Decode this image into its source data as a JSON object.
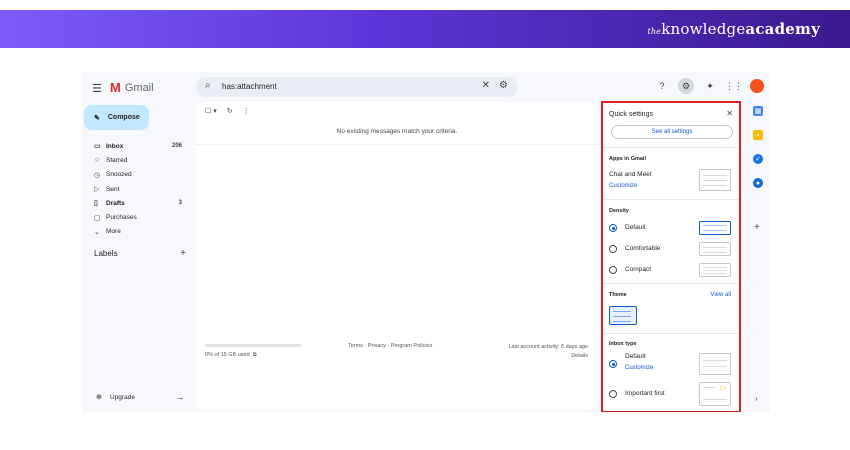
{
  "banner": {
    "brand_the": "the",
    "brand_knowledge": "knowledge",
    "brand_academy": "academy"
  },
  "app": {
    "name": "Gmail"
  },
  "search": {
    "query": "has:attachment"
  },
  "compose": {
    "label": "Compose"
  },
  "nav": [
    {
      "label": "Inbox",
      "count": "206",
      "icon": "inbox-icon",
      "glyph": "▭",
      "bold": true
    },
    {
      "label": "Starred",
      "count": "",
      "icon": "star-icon",
      "glyph": "☆",
      "bold": false
    },
    {
      "label": "Snoozed",
      "count": "",
      "icon": "clock-icon",
      "glyph": "◷",
      "bold": false
    },
    {
      "label": "Sent",
      "count": "",
      "icon": "send-icon",
      "glyph": "▷",
      "bold": false
    },
    {
      "label": "Drafts",
      "count": "3",
      "icon": "draft-icon",
      "glyph": "▯",
      "bold": true
    },
    {
      "label": "Purchases",
      "count": "",
      "icon": "bag-icon",
      "glyph": "▢",
      "bold": false
    },
    {
      "label": "More",
      "count": "",
      "icon": "chevron-down-icon",
      "glyph": "⌄",
      "bold": false
    }
  ],
  "labels": {
    "title": "Labels"
  },
  "upgrade": {
    "label": "Upgrade"
  },
  "main": {
    "empty": "No existing messages match your criteria.",
    "storage": "0% of 15 GB used",
    "storage_fraction": 0,
    "footer": "Terms · Privacy · Program Policies",
    "activity_line1": "Last account activity: 6 days ago",
    "activity_line2": "Details"
  },
  "quick_settings": {
    "title": "Quick settings",
    "see_all": "See all settings",
    "apps_section": "Apps in Gmail",
    "chat_meet": "Chat and Meet",
    "customize": "Customize",
    "density_section": "Density",
    "density": [
      {
        "label": "Default",
        "selected": true
      },
      {
        "label": "Comfortable",
        "selected": false
      },
      {
        "label": "Compact",
        "selected": false
      }
    ],
    "theme_section": "Theme",
    "view_all": "View all",
    "inbox_section": "Inbox type",
    "inbox_default": "Default",
    "inbox_customize": "Customize",
    "important_first": "Important first"
  },
  "colors": {
    "accent": "#0b57d0",
    "highlight": "#e02020",
    "compose_bg": "#c2e7ff"
  }
}
